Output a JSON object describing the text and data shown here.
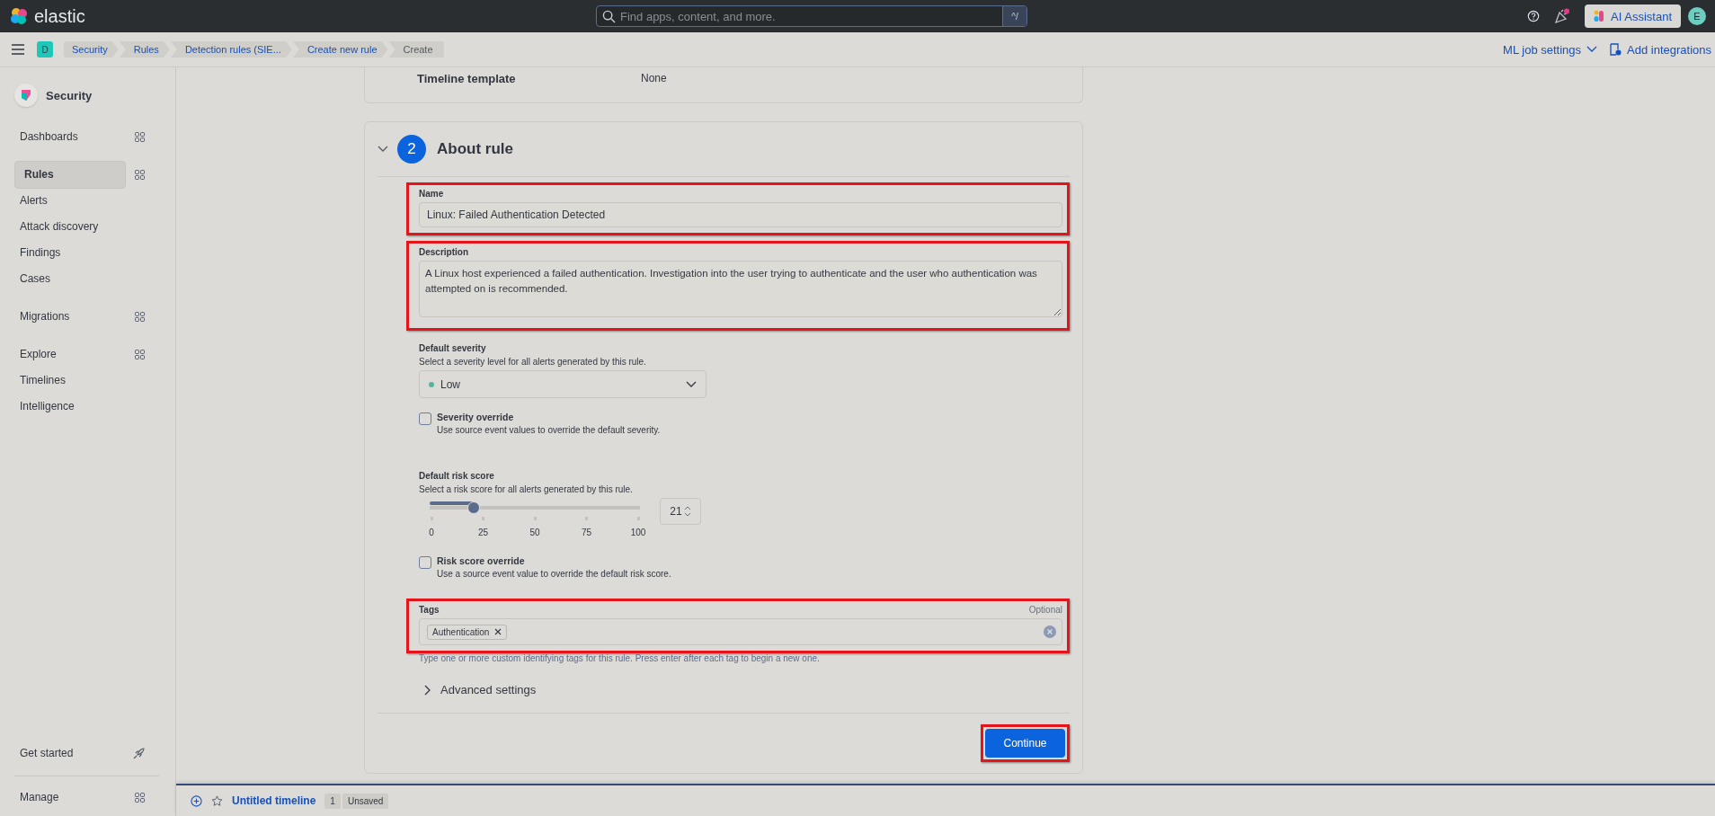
{
  "header": {
    "brand": "elastic",
    "search": {
      "placeholder": "Find apps, content, and more.",
      "shortcut": "^/"
    },
    "ai_assistant": "AI Assistant",
    "avatar": "E"
  },
  "breadcrumb_bar": {
    "space": "D",
    "breadcrumbs": [
      {
        "label": "Security",
        "current": false
      },
      {
        "label": "Rules",
        "current": false
      },
      {
        "label": "Detection rules (SIE...",
        "current": false
      },
      {
        "label": "Create new rule",
        "current": false
      },
      {
        "label": "Create",
        "current": true
      }
    ],
    "ml_job_settings": "ML job settings",
    "add_integrations": "Add integrations"
  },
  "sidebar": {
    "title": "Security",
    "sections": [
      {
        "items": [
          {
            "label": "Dashboards",
            "kind": "launcher",
            "selected": false
          }
        ]
      },
      {
        "items": [
          {
            "label": "Rules",
            "kind": "launcher",
            "selected": true
          },
          {
            "label": "Alerts",
            "kind": "link",
            "selected": false
          },
          {
            "label": "Attack discovery",
            "kind": "link",
            "selected": false
          },
          {
            "label": "Findings",
            "kind": "link",
            "selected": false
          },
          {
            "label": "Cases",
            "kind": "link",
            "selected": false
          }
        ]
      },
      {
        "items": [
          {
            "label": "Migrations",
            "kind": "launcher",
            "selected": false
          }
        ]
      },
      {
        "items": [
          {
            "label": "Explore",
            "kind": "launcher",
            "selected": false
          },
          {
            "label": "Timelines",
            "kind": "link",
            "selected": false
          },
          {
            "label": "Intelligence",
            "kind": "link",
            "selected": false
          }
        ]
      }
    ],
    "footer": [
      {
        "label": "Get started",
        "kind": "rocket",
        "selected": false
      },
      {
        "label": "Manage",
        "kind": "launcher",
        "selected": false
      }
    ]
  },
  "timeline_template": {
    "label": "Timeline template",
    "value": "None"
  },
  "about_rule": {
    "step": "2",
    "title": "About rule",
    "expanded": true,
    "name": {
      "label": "Name",
      "value": "Linux: Failed Authentication Detected",
      "highlighted": true
    },
    "description": {
      "label": "Description",
      "value": "A Linux host experienced a failed authentication. Investigation into the user trying to authenticate and the user who authentication was attempted on is recommended.",
      "highlighted": true
    },
    "severity": {
      "label": "Default severity",
      "help": "Select a severity level for all alerts generated by this rule.",
      "value": "Low",
      "color": "#54b399"
    },
    "severity_override": {
      "label": "Severity override",
      "help": "Use source event values to override the default severity.",
      "checked": false
    },
    "risk_score": {
      "label": "Default risk score",
      "help": "Select a risk score for all alerts generated by this rule.",
      "level": 0.21,
      "ticks": [
        "0",
        "25",
        "50",
        "75",
        "100"
      ],
      "value": "21"
    },
    "risk_override": {
      "label": "Risk score override",
      "help": "Use a source event value to override the default risk score.",
      "checked": false
    },
    "tags": {
      "label": "Tags",
      "optional": "Optional",
      "chips": [
        "Authentication"
      ],
      "help": "Type one or more custom identifying tags for this rule. Press enter after each tag to begin a new one.",
      "highlighted": true
    },
    "advanced": {
      "label": "Advanced settings",
      "expanded": false
    },
    "continue": {
      "label": "Continue",
      "highlighted": true
    }
  },
  "timeline_bar": {
    "title": "Untitled timeline",
    "count": "1",
    "status": "Unsaved"
  }
}
